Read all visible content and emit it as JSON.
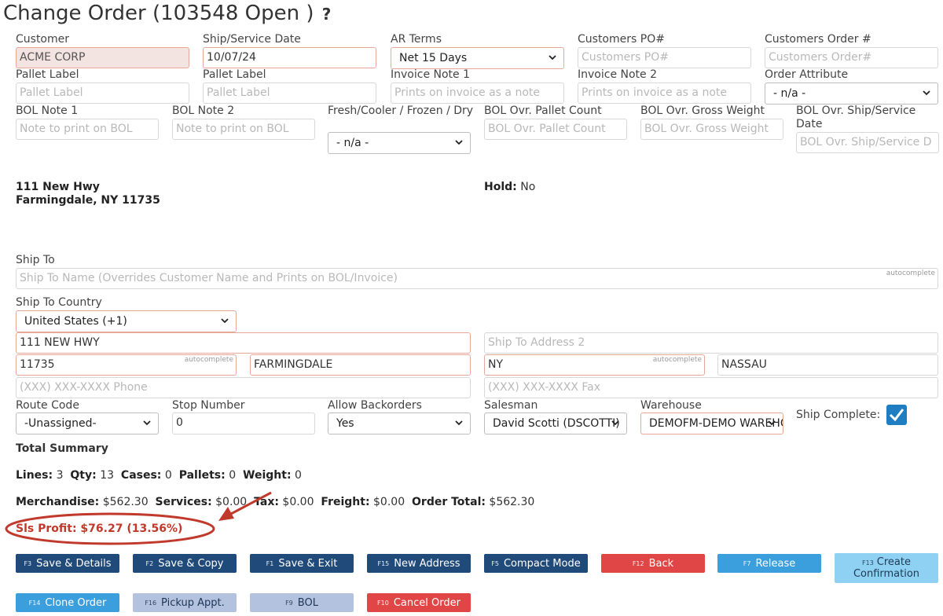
{
  "page": {
    "title": "Change Order (103548 Open )",
    "help_glyph": "?"
  },
  "row1": {
    "customer": {
      "label": "Customer",
      "value": "ACME CORP"
    },
    "ship_date": {
      "label": "Ship/Service Date",
      "value": "10/07/24"
    },
    "ar_terms": {
      "label": "AR Terms",
      "value": "Net 15 Days"
    },
    "cust_po": {
      "label": "Customers PO#",
      "placeholder": "Customers PO#"
    },
    "cust_order": {
      "label": "Customers Order #",
      "placeholder": "Customers Order#"
    }
  },
  "row2": {
    "pallet_label_1": {
      "label": "Pallet Label",
      "placeholder": "Pallet Label"
    },
    "pallet_label_2": {
      "label": "Pallet Label",
      "placeholder": "Pallet Label"
    },
    "invoice_note_1": {
      "label": "Invoice Note 1",
      "placeholder": "Prints on invoice as a note"
    },
    "invoice_note_2": {
      "label": "Invoice Note 2",
      "placeholder": "Prints on invoice as a note"
    },
    "order_attribute": {
      "label": "Order Attribute",
      "value": "- n/a -"
    }
  },
  "row3": {
    "bol_note_1": {
      "label": "BOL Note 1",
      "placeholder": "Note to print on BOL"
    },
    "bol_note_2": {
      "label": "BOL Note 2",
      "placeholder": "Note to print on BOL"
    },
    "fresh": {
      "label": "Fresh/Cooler / Frozen / Dry",
      "value": "- n/a -"
    },
    "pallet_count": {
      "label": "BOL Ovr. Pallet Count",
      "placeholder": "BOL Ovr. Pallet Count"
    },
    "gross_weight": {
      "label": "BOL Ovr. Gross Weight",
      "placeholder": "BOL Ovr. Gross Weight"
    },
    "ship_service_date": {
      "label": "BOL Ovr. Ship/Service Date",
      "placeholder": "BOL Ovr. Ship/Service D"
    }
  },
  "address": {
    "line1": "111 New Hwy",
    "line2": "Farmingdale, NY 11735",
    "hold_label": "Hold:",
    "hold_value": "No"
  },
  "ship_to": {
    "label": "Ship To",
    "name_placeholder": "Ship To Name (Overrides Customer Name and Prints on BOL/Invoice)",
    "autocomplete_tag": "autocomplete",
    "country_label": "Ship To Country",
    "country_value": "United States (+1)",
    "address1": "111 NEW HWY",
    "address2_placeholder": "Ship To Address 2",
    "zip": "11735",
    "city": "FARMINGDALE",
    "state": "NY",
    "county": "NASSAU",
    "phone_placeholder": "(XXX) XXX-XXXX Phone",
    "fax_placeholder": "(XXX) XXX-XXXX Fax"
  },
  "options": {
    "route_code": {
      "label": "Route Code",
      "value": "-Unassigned-"
    },
    "stop_number": {
      "label": "Stop Number",
      "value": "0"
    },
    "allow_backorders": {
      "label": "Allow Backorders",
      "value": "Yes"
    },
    "salesman": {
      "label": "Salesman",
      "value": "David Scotti (DSCOTTI)"
    },
    "warehouse": {
      "label": "Warehouse",
      "value": "DEMOFM-DEMO WAREHOUSE"
    },
    "ship_complete": {
      "label": "Ship Complete:"
    }
  },
  "summary": {
    "heading": "Total Summary",
    "lines_label": "Lines:",
    "lines": "3",
    "qty_label": "Qty:",
    "qty": "13",
    "cases_label": "Cases:",
    "cases": "0",
    "pallets_label": "Pallets:",
    "pallets": "0",
    "weight_label": "Weight:",
    "weight": "0",
    "merch_label": "Merchandise:",
    "merch": "$562.30",
    "services_label": "Services:",
    "services": "$0.00",
    "tax_label": "Tax:",
    "tax": "$0.00",
    "freight_label": "Freight:",
    "freight": "$0.00",
    "total_label": "Order Total:",
    "total": "$562.30",
    "profit": "Sls Profit: $76.27 (13.56%)"
  },
  "buttons": [
    {
      "key": "F3",
      "label": "Save & Details"
    },
    {
      "key": "F2",
      "label": "Save & Copy"
    },
    {
      "key": "F1",
      "label": "Save & Exit"
    },
    {
      "key": "F15",
      "label": "New Address"
    },
    {
      "key": "F5",
      "label": "Compact Mode"
    },
    {
      "key": "F12",
      "label": "Back"
    },
    {
      "key": "F7",
      "label": "Release"
    },
    {
      "key": "F13",
      "label": "Create",
      "label2": "Confirmation"
    },
    {
      "key": "F14",
      "label": "Clone Order"
    },
    {
      "key": "F16",
      "label": "Pickup Appt."
    },
    {
      "key": "F9",
      "label": "BOL"
    },
    {
      "key": "F10",
      "label": "Cancel Order"
    }
  ],
  "colors": {
    "navy": "#1f4a7a",
    "red": "#e04646",
    "blue": "#3a9fdc",
    "annotation": "#c0392b"
  }
}
